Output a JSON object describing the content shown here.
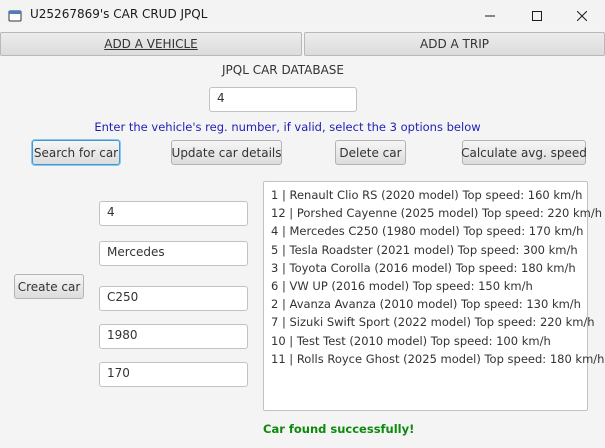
{
  "window": {
    "title": "U25267869's CAR CRUD JPQL",
    "controls": [
      "minimize",
      "maximize",
      "close"
    ]
  },
  "tabs": [
    {
      "label": "ADD A VEHICLE",
      "selected": true
    },
    {
      "label": "ADD A TRIP",
      "selected": false
    }
  ],
  "main": {
    "heading": "JPQL CAR DATABASE",
    "search_value": "4",
    "hint": "Enter the vehicle's reg. number, if valid, select the 3 options below",
    "buttons": {
      "search": "Search for car",
      "update": "Update car details",
      "delete": "Delete car",
      "avg_speed": "Calculate avg. speed",
      "create": "Create car"
    },
    "form": {
      "reg_number": "4",
      "make": "Mercedes",
      "model": "C250",
      "year": "1980",
      "top_speed": "170"
    },
    "car_list": [
      "1 | Renault Clio RS (2020 model) Top speed: 160 km/h",
      "12 | Porshed Cayenne (2025 model) Top speed: 220 km/h",
      "4 | Mercedes C250 (1980 model) Top speed: 170 km/h",
      "5 | Tesla Roadster (2021 model) Top speed: 300 km/h",
      "3 | Toyota Corolla (2016 model) Top speed: 180 km/h",
      "6 | VW UP (2016 model) Top speed: 150 km/h",
      "2 | Avanza Avanza (2010 model) Top speed: 130 km/h",
      "7 | Sizuki Swift Sport (2022 model) Top speed: 220 km/h",
      "10 | Test Test (2010 model) Top speed: 100 km/h",
      "11 | Rolls Royce Ghost (2025 model) Top speed: 180 km/h"
    ],
    "status": "Car found successfully!"
  },
  "colors": {
    "hint": "#1e1eb8",
    "status": "#0c8a0c",
    "focus": "#3c9ad6"
  }
}
